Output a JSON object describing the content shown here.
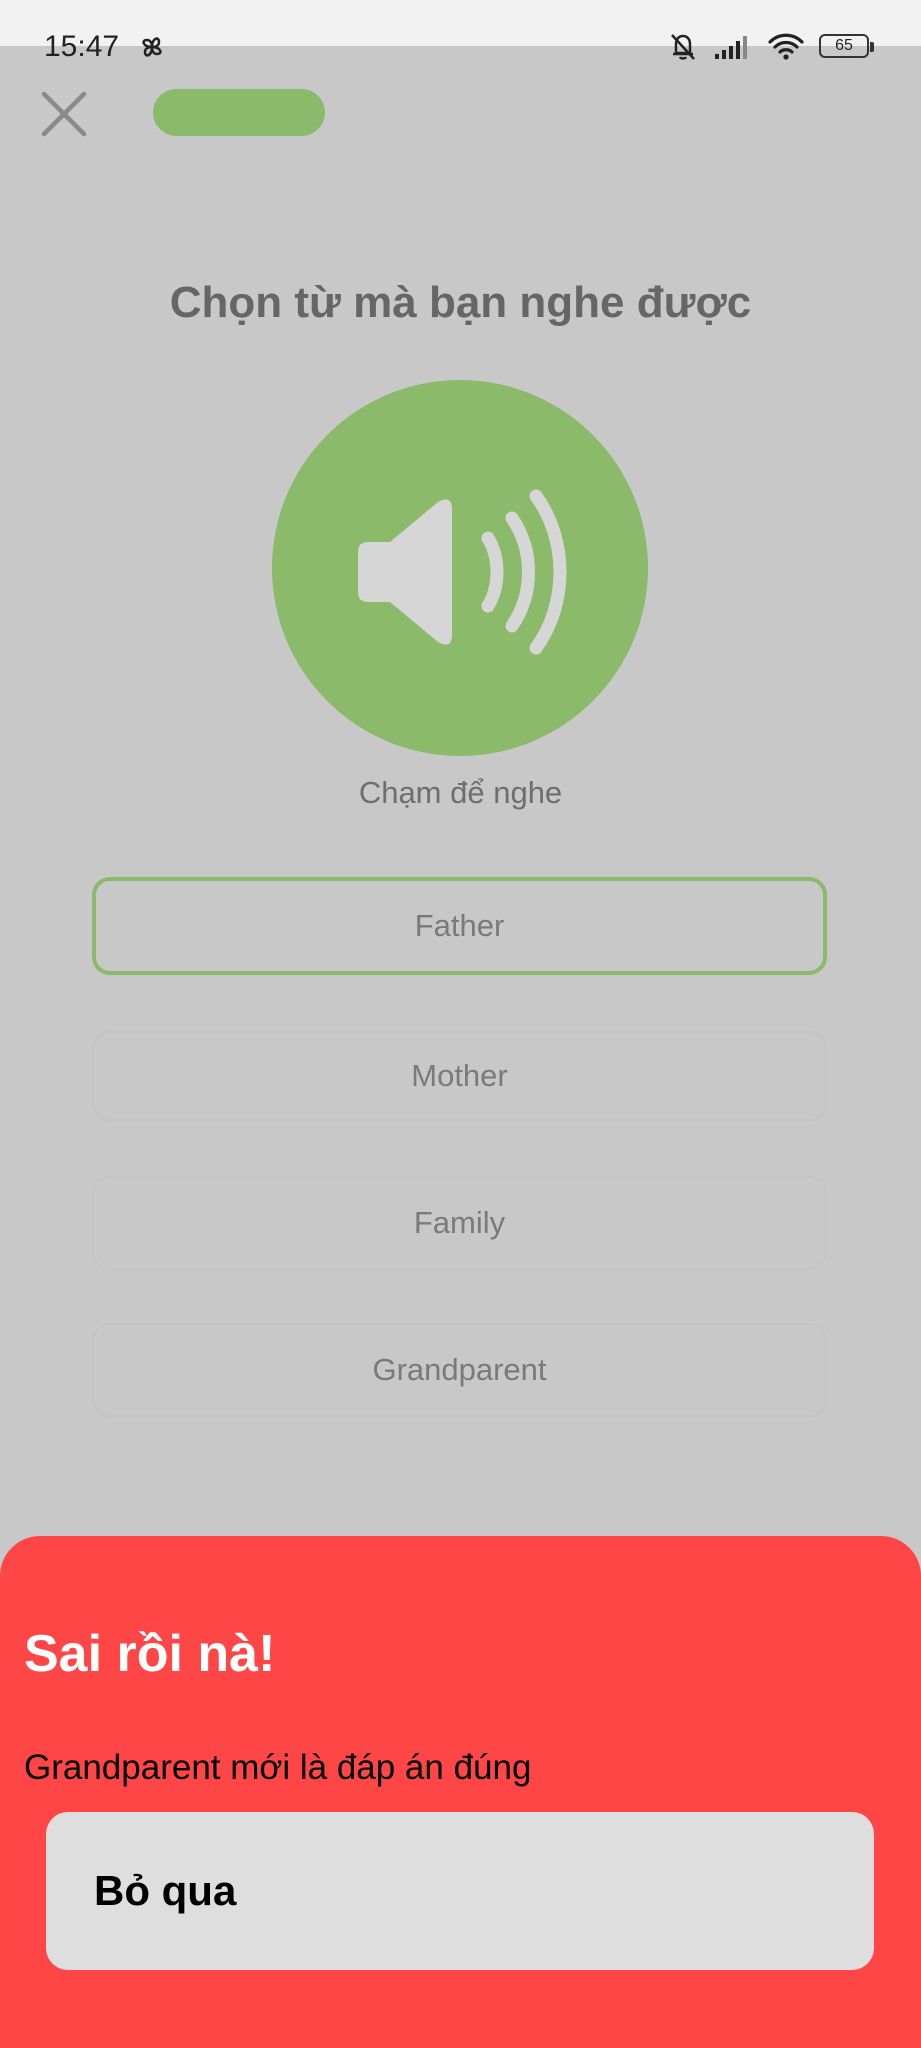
{
  "status_bar": {
    "time": "15:47",
    "battery": "65",
    "icons": [
      "pinwheel-icon",
      "bell-off-icon",
      "signal-icon",
      "wifi-icon",
      "battery-icon"
    ]
  },
  "header": {
    "close_icon": "close-icon",
    "progress_fraction": 1.0
  },
  "exercise": {
    "prompt": "Chọn từ mà bạn nghe được",
    "speaker_icon": "speaker-icon",
    "tap_label": "Chạm để nghe",
    "options": [
      {
        "label": "Father",
        "selected": true
      },
      {
        "label": "Mother",
        "selected": false
      },
      {
        "label": "Family",
        "selected": false
      },
      {
        "label": "Grandparent",
        "selected": false
      }
    ]
  },
  "feedback": {
    "title": "Sai rồi nà!",
    "message": "Grandparent mới là đáp án đúng",
    "skip_label": "Bỏ qua"
  },
  "colors": {
    "accent_green": "#8bbb6a",
    "error_red": "#ff4646",
    "dim_background": "#c8c8c8"
  }
}
